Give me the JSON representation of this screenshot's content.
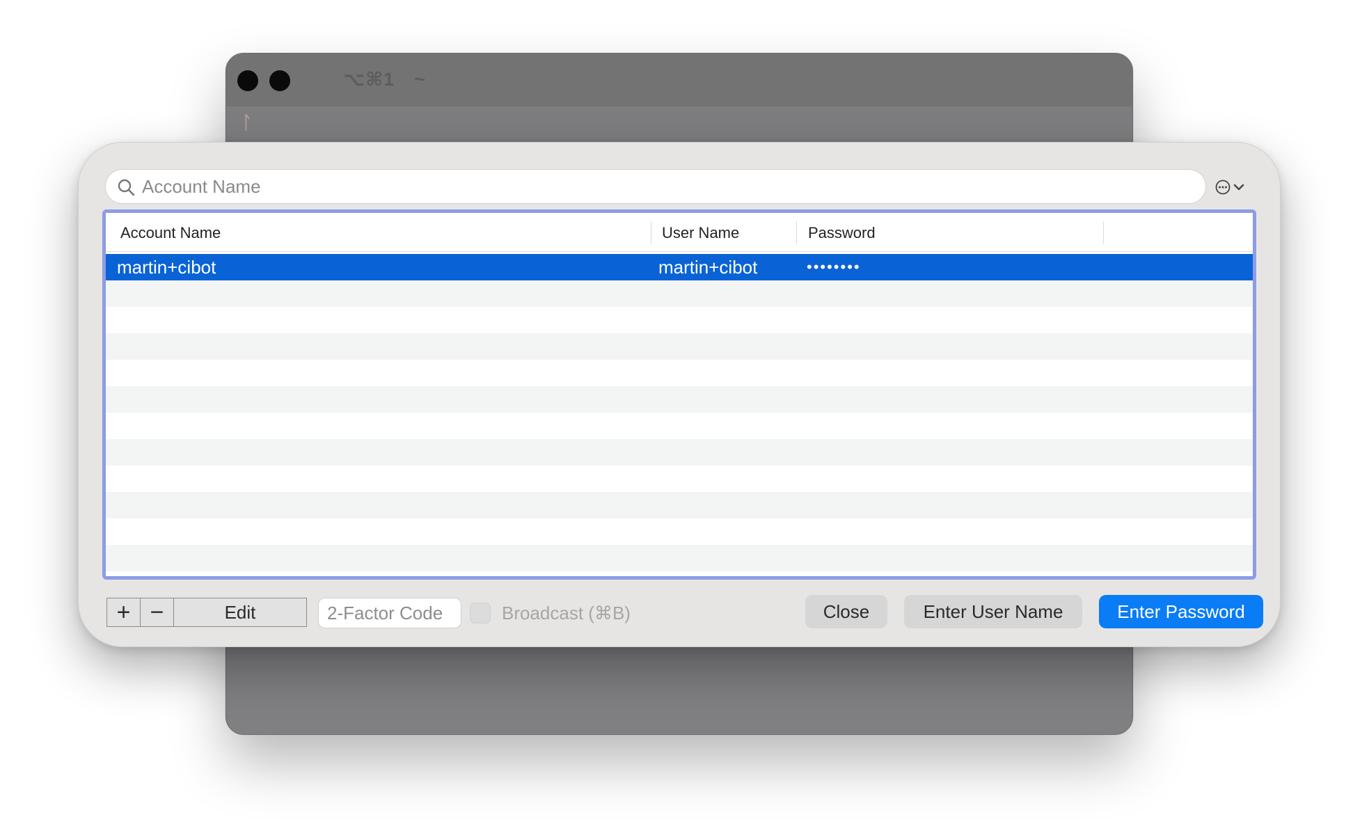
{
  "terminal": {
    "title_shortcut": "⌥⌘1",
    "title_path": "~",
    "branch_symbol": "ᛚ"
  },
  "search": {
    "placeholder": "Account Name",
    "value": ""
  },
  "table": {
    "columns": [
      "Account Name",
      "User Name",
      "Password"
    ],
    "rows": [
      {
        "account": "martin+cibot",
        "user": "martin+cibot",
        "password": "••••••••",
        "selected": true
      }
    ]
  },
  "bottom_bar": {
    "add_label": "+",
    "remove_label": "−",
    "edit_label": "Edit",
    "twofa_placeholder": "2-Factor Code",
    "broadcast_label": "Broadcast (⌘B)",
    "close_label": "Close",
    "enter_user_label": "Enter User Name",
    "enter_password_label": "Enter Password"
  },
  "colors": {
    "selection": "#0a63d6",
    "primary_button": "#0a7cf5",
    "focus_ring": "#8c9ce6"
  }
}
